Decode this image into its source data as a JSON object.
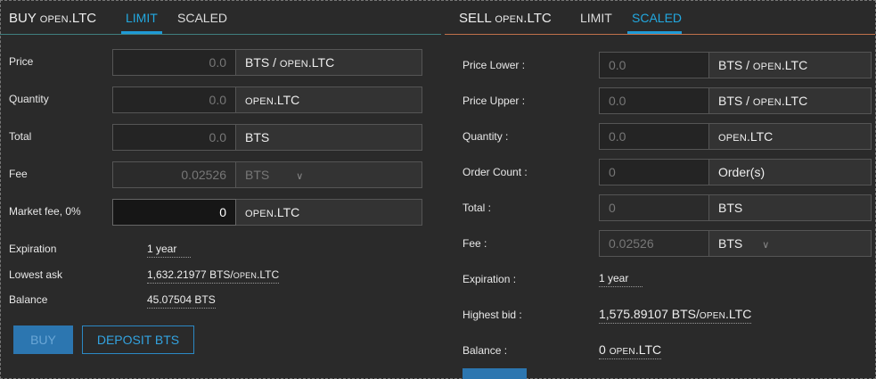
{
  "buy": {
    "title_main": "BUY ",
    "title_asset_prefix": "OPEN",
    "title_asset_suffix": ".LTC",
    "tabs": [
      "LIMIT",
      "SCALED"
    ],
    "price_label": "Price",
    "price_value": "0.0",
    "price_unit_main": "BTS / ",
    "price_unit_prefix": "OPEN",
    "price_unit_suffix": ".LTC",
    "quantity_label": "Quantity",
    "quantity_value": "0.0",
    "quantity_unit_prefix": "OPEN",
    "quantity_unit_suffix": ".LTC",
    "total_label": "Total",
    "total_value": "0.0",
    "total_unit": "BTS",
    "fee_label": "Fee",
    "fee_value": "0.02526",
    "fee_unit": "BTS",
    "market_fee_label": "Market fee, 0%",
    "market_fee_value": "0",
    "market_fee_unit_prefix": "OPEN",
    "market_fee_unit_suffix": ".LTC",
    "expiration_label": "Expiration",
    "expiration_value": "1 year",
    "lowest_ask_label": "Lowest ask",
    "lowest_ask_value_main": "1,632.21977 BTS/",
    "lowest_ask_value_prefix": "OPEN",
    "lowest_ask_value_suffix": ".LTC",
    "balance_label": "Balance",
    "balance_value": "45.07504 BTS",
    "buy_button": "BUY",
    "deposit_button": "DEPOSIT BTS"
  },
  "sell": {
    "title_main": "SELL ",
    "title_asset_prefix": "OPEN",
    "title_asset_suffix": ".LTC",
    "tabs": [
      "LIMIT",
      "SCALED"
    ],
    "price_lower_label": "Price Lower :",
    "price_lower_value": "0.0",
    "price_lower_unit_main": "BTS / ",
    "price_lower_unit_prefix": "OPEN",
    "price_lower_unit_suffix": ".LTC",
    "price_upper_label": "Price Upper :",
    "price_upper_value": "0.0",
    "price_upper_unit_main": "BTS / ",
    "price_upper_unit_prefix": "OPEN",
    "price_upper_unit_suffix": ".LTC",
    "quantity_label": "Quantity :",
    "quantity_value": "0.0",
    "quantity_unit_prefix": "OPEN",
    "quantity_unit_suffix": ".LTC",
    "order_count_label": "Order Count :",
    "order_count_value": "0",
    "order_count_unit": "Order(s)",
    "total_label": "Total :",
    "total_value": "0",
    "total_unit": "BTS",
    "fee_label": "Fee :",
    "fee_value": "0.02526",
    "fee_unit": "BTS",
    "expiration_label": "Expiration :",
    "expiration_value": "1 year",
    "highest_bid_label": "Highest bid :",
    "highest_bid_value_main": "1,575.89107 BTS/",
    "highest_bid_value_prefix": "OPEN",
    "highest_bid_value_suffix": ".LTC",
    "balance_label": "Balance :",
    "balance_value_main": "0 ",
    "balance_value_prefix": "OPEN",
    "balance_value_suffix": ".LTC"
  },
  "icons": {
    "dropdown": "chevron-down-icon"
  },
  "colors": {
    "accent": "#22a8e0",
    "buy_line": "#3f7f7f",
    "sell_line": "#c0714a",
    "button_primary": "#2c76b0"
  }
}
